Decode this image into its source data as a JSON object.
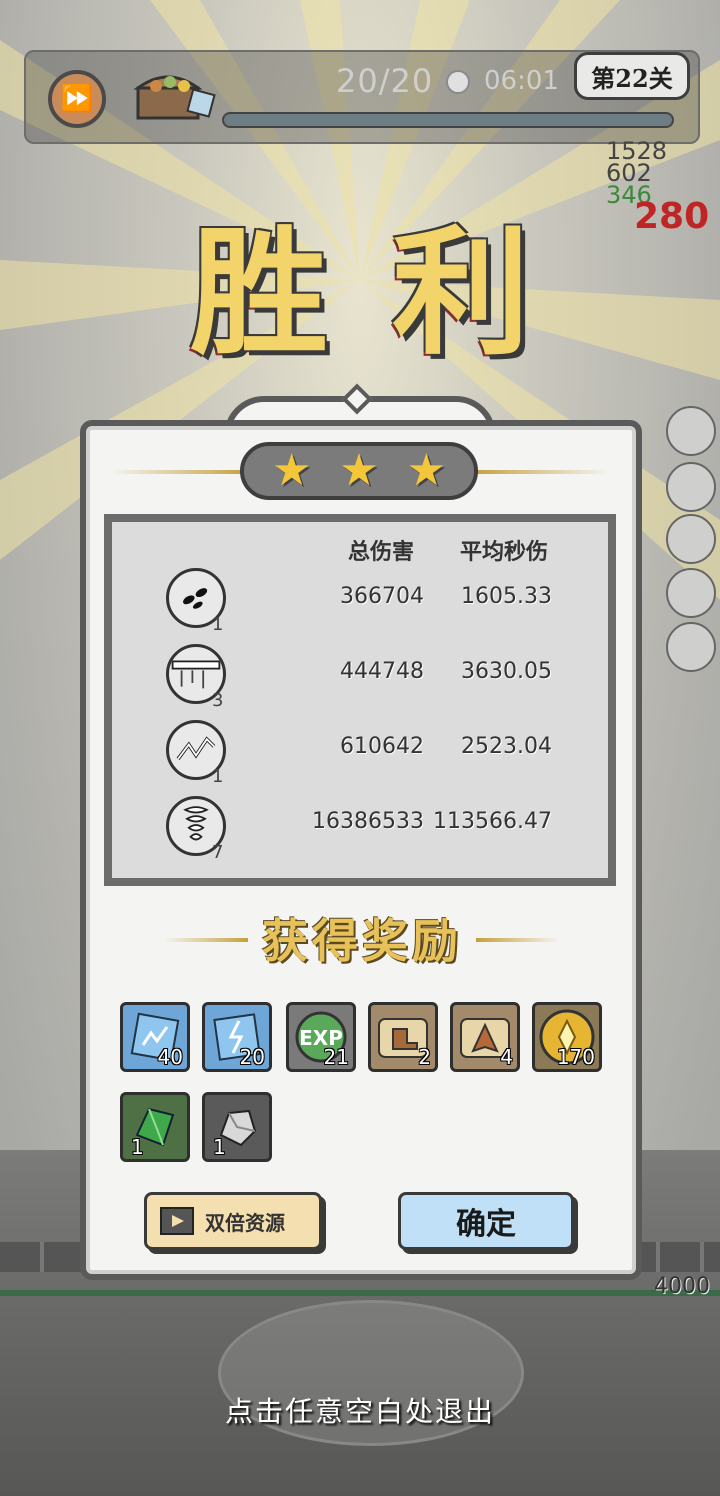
{
  "hud": {
    "wave": "20/20",
    "time": "06:01",
    "level": "第22关",
    "side_numbers": [
      "1528",
      "602",
      "346"
    ],
    "crit_number": "280",
    "base_hp": "4000"
  },
  "victory": {
    "char1": "胜",
    "char2": "利"
  },
  "stars": 3,
  "stats": {
    "col_total": "总伤害",
    "col_dps": "平均秒伤",
    "rows": [
      {
        "icon": "seed-skill-icon",
        "level": "1",
        "total": "366704",
        "dps": "1605.33"
      },
      {
        "icon": "chain-skill-icon",
        "level": "3",
        "total": "444748",
        "dps": "3630.05"
      },
      {
        "icon": "lightning-skill-icon",
        "level": "1",
        "total": "610642",
        "dps": "2523.04"
      },
      {
        "icon": "tornado-skill-icon",
        "level": "7",
        "total": "16386533",
        "dps": "113566.47"
      }
    ]
  },
  "rewards": {
    "title": "获得奖励",
    "items": [
      {
        "icon": "blue-lightning-crystal-icon",
        "count": "40"
      },
      {
        "icon": "blue-thunder-crystal-icon",
        "count": "20"
      },
      {
        "icon": "exp-icon",
        "count": "21"
      },
      {
        "icon": "boots-scroll-icon",
        "count": "2"
      },
      {
        "icon": "cloak-scroll-icon",
        "count": "4"
      },
      {
        "icon": "gold-coin-icon",
        "count": "170"
      },
      {
        "icon": "green-gem-icon",
        "count": "1"
      },
      {
        "icon": "silver-ore-icon",
        "count": "1"
      }
    ]
  },
  "buttons": {
    "double": "双倍资源",
    "confirm": "确定"
  },
  "exit_hint": "点击任意空白处退出",
  "colors": {
    "gold": "#f3d46a",
    "confirm_bg": "#bfe0f6",
    "double_bg": "#f3dfb0"
  }
}
